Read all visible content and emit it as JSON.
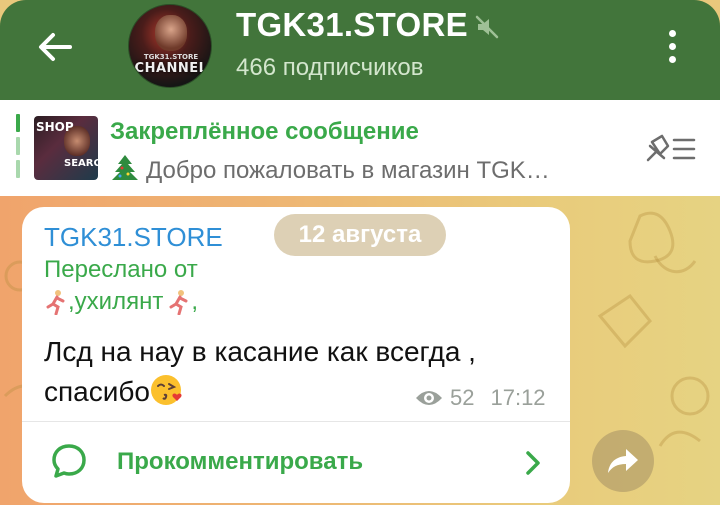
{
  "header": {
    "title": "TGK31.STORE",
    "subscribers": "466 подписчиков",
    "avatar_small_text": "TGK31.STORE",
    "avatar_big_text": "CHANNEL",
    "back_icon": "arrow-left-icon",
    "mute_icon": "muted-speaker-icon",
    "menu_icon": "vertical-dots-icon",
    "color": "#42753b"
  },
  "pinned": {
    "title": "Закреплённое сообщение",
    "text": "Добро пожаловать в магазин TGK…",
    "thumb_text_top": "SHOP",
    "thumb_text_bottom": "SEARCH",
    "list_icon": "pin-list-icon",
    "accent": "#3aa94a"
  },
  "message": {
    "sender": "TGK31.STORE",
    "date": "12 августа",
    "forwarded_label": "Переслано от",
    "forwarded_from": ",ухилянт",
    "text": "Лсд на нау в касание как всегда , спасибо",
    "views": "52",
    "time": "17:12",
    "comment_label": "Прокомментировать",
    "sender_color": "#2f8fd6"
  },
  "share_icon": "share-arrow-icon"
}
